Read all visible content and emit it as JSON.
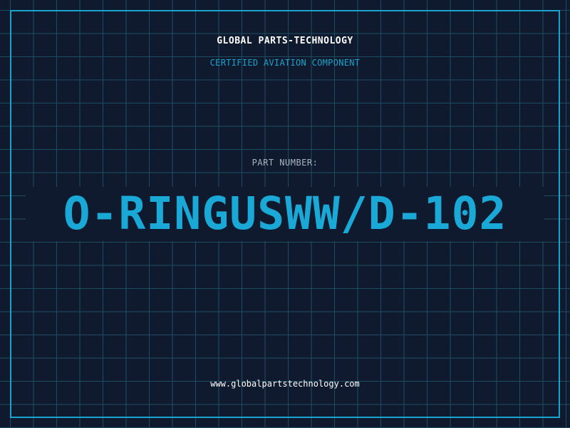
{
  "header": {
    "company": "GLOBAL PARTS-TECHNOLOGY",
    "subtitle": "CERTIFIED AVIATION COMPONENT"
  },
  "part": {
    "label": "PART NUMBER:",
    "number": "O-RINGUSWW/D-102"
  },
  "footer": {
    "url": "www.globalpartstechnology.com"
  },
  "colors": {
    "background": "#101a2e",
    "grid": "#1e4d63",
    "accent": "#1aa3cc",
    "text": "#ffffff",
    "muted": "#a9b4c2"
  }
}
